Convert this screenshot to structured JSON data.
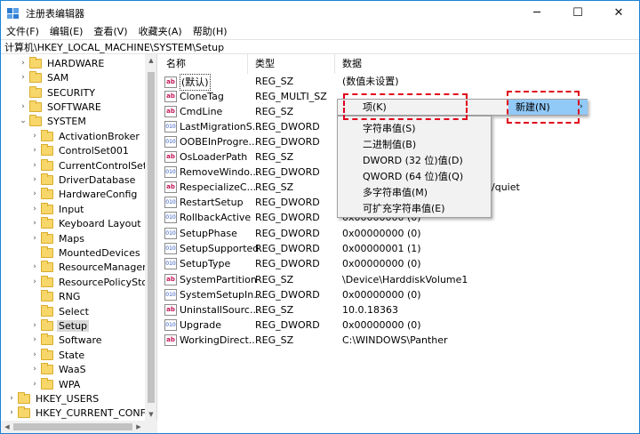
{
  "window": {
    "title": "注册表编辑器",
    "min": "─",
    "max": "☐",
    "close": "✕"
  },
  "menu": [
    "文件(F)",
    "编辑(E)",
    "查看(V)",
    "收藏夹(A)",
    "帮助(H)"
  ],
  "address": "计算机\\HKEY_LOCAL_MACHINE\\SYSTEM\\Setup",
  "tree": [
    {
      "label": "HARDWARE",
      "arrow": "›"
    },
    {
      "label": "SAM",
      "arrow": "›"
    },
    {
      "label": "SECURITY",
      "arrow": ""
    },
    {
      "label": "SOFTWARE",
      "arrow": "›"
    },
    {
      "label": "SYSTEM",
      "arrow": "⌄"
    },
    {
      "label": "ActivationBroker",
      "arrow": "›"
    },
    {
      "label": "ControlSet001",
      "arrow": "›"
    },
    {
      "label": "CurrentControlSet",
      "arrow": "›"
    },
    {
      "label": "DriverDatabase",
      "arrow": "›"
    },
    {
      "label": "HardwareConfig",
      "arrow": "›"
    },
    {
      "label": "Input",
      "arrow": "›"
    },
    {
      "label": "Keyboard Layout",
      "arrow": "›"
    },
    {
      "label": "Maps",
      "arrow": "›"
    },
    {
      "label": "MountedDevices",
      "arrow": ""
    },
    {
      "label": "ResourceManager",
      "arrow": "›"
    },
    {
      "label": "ResourcePolicySto",
      "arrow": "›"
    },
    {
      "label": "RNG",
      "arrow": ""
    },
    {
      "label": "Select",
      "arrow": ""
    },
    {
      "label": "Setup",
      "arrow": "›"
    },
    {
      "label": "Software",
      "arrow": "›"
    },
    {
      "label": "State",
      "arrow": "›"
    },
    {
      "label": "WaaS",
      "arrow": "›"
    },
    {
      "label": "WPA",
      "arrow": "›"
    },
    {
      "label": "HKEY_USERS",
      "arrow": "›"
    },
    {
      "label": "HKEY_CURRENT_CONFIG",
      "arrow": "›"
    }
  ],
  "columns": {
    "name": "名称",
    "type": "类型",
    "data": "数据"
  },
  "values": [
    {
      "name": "(默认)",
      "type": "REG_SZ",
      "data": "(数值未设置)",
      "icon": "ab"
    },
    {
      "name": "CloneTag",
      "type": "REG_MULTI_SZ",
      "data": "",
      "icon": "ab"
    },
    {
      "name": "CmdLine",
      "type": "REG_SZ",
      "data": "",
      "icon": "ab"
    },
    {
      "name": "LastMigrationS...",
      "type": "REG_DWORD",
      "data": "",
      "icon": "010"
    },
    {
      "name": "OOBEInProgre...",
      "type": "REG_DWORD",
      "data": "",
      "icon": "010"
    },
    {
      "name": "OsLoaderPath",
      "type": "REG_SZ",
      "data": "",
      "icon": "ab"
    },
    {
      "name": "RemoveWindo...",
      "type": "REG_DWORD",
      "data": "",
      "icon": "010"
    },
    {
      "name": "RespecializeC...",
      "type": "REG_SZ",
      "data": "/quiet",
      "icon": "ab"
    },
    {
      "name": "RestartSetup",
      "type": "REG_DWORD",
      "data": "",
      "icon": "010"
    },
    {
      "name": "RollbackActive",
      "type": "REG_DWORD",
      "data": "0x00000000 (0)",
      "icon": "010"
    },
    {
      "name": "SetupPhase",
      "type": "REG_DWORD",
      "data": "0x00000000 (0)",
      "icon": "010"
    },
    {
      "name": "SetupSupported",
      "type": "REG_DWORD",
      "data": "0x00000001 (1)",
      "icon": "010"
    },
    {
      "name": "SetupType",
      "type": "REG_DWORD",
      "data": "0x00000000 (0)",
      "icon": "010"
    },
    {
      "name": "SystemPartition",
      "type": "REG_SZ",
      "data": "\\Device\\HarddiskVolume1",
      "icon": "ab"
    },
    {
      "name": "SystemSetupIn...",
      "type": "REG_DWORD",
      "data": "0x00000000 (0)",
      "icon": "010"
    },
    {
      "name": "UninstallSourc...",
      "type": "REG_SZ",
      "data": "10.0.18363",
      "icon": "ab"
    },
    {
      "name": "Upgrade",
      "type": "REG_DWORD",
      "data": "0x00000000 (0)",
      "icon": "010"
    },
    {
      "name": "WorkingDirect...",
      "type": "REG_SZ",
      "data": "C:\\WINDOWS\\Panther",
      "icon": "ab"
    }
  ],
  "context_menu": {
    "item_key": "项(K)",
    "new": "新建(N)",
    "new_arrow": "›",
    "items": [
      "字符串值(S)",
      "二进制值(B)",
      "DWORD (32 位)值(D)",
      "QWORD (64 位)值(Q)",
      "多字符串值(M)",
      "可扩充字符串值(E)"
    ]
  },
  "colors": {
    "accent": "#1883d7",
    "highlight_dash": "#e0001b",
    "menu_hover": "#91c9f7"
  }
}
